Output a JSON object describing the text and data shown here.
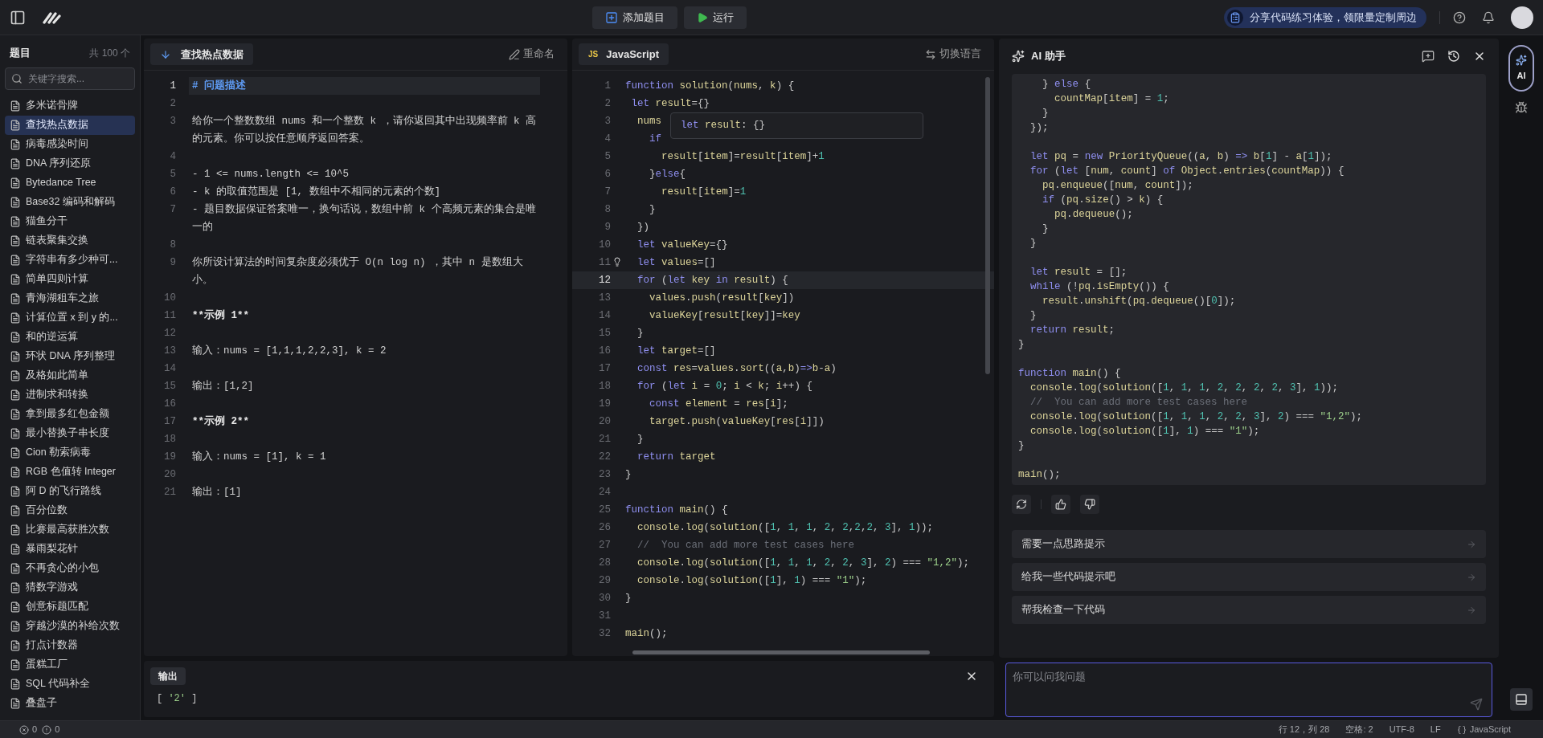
{
  "top_bar": {
    "buttons": [
      {
        "label": "添加题目",
        "kind": "add"
      },
      {
        "label": "运行",
        "kind": "run"
      }
    ],
    "promo": "分享代码练习体验，领限量定制周边"
  },
  "sidebar": {
    "title": "题目",
    "count": "共 100 个",
    "search": {
      "placeholder": "关键字搜索..."
    },
    "items": [
      {
        "label": "多米诺骨牌",
        "selected": false
      },
      {
        "label": "查找热点数据",
        "selected": true
      },
      {
        "label": "病毒感染时间",
        "selected": false
      },
      {
        "label": "DNA 序列还原",
        "selected": false
      },
      {
        "label": "Bytedance Tree",
        "selected": false
      },
      {
        "label": "Base32 编码和解码",
        "selected": false
      },
      {
        "label": "猫鱼分干",
        "selected": false
      },
      {
        "label": "链表聚集交换",
        "selected": false
      },
      {
        "label": "字符串有多少种可...",
        "selected": false
      },
      {
        "label": "简单四则计算",
        "selected": false
      },
      {
        "label": "青海湖租车之旅",
        "selected": false
      },
      {
        "label": "计算位置 x 到 y 的...",
        "selected": false
      },
      {
        "label": "和的逆运算",
        "selected": false
      },
      {
        "label": "环状 DNA 序列整理",
        "selected": false
      },
      {
        "label": "及格如此简单",
        "selected": false
      },
      {
        "label": "进制求和转换",
        "selected": false
      },
      {
        "label": "拿到最多红包金额",
        "selected": false
      },
      {
        "label": "最小替换子串长度",
        "selected": false
      },
      {
        "label": "Cion 勒索病毒",
        "selected": false
      },
      {
        "label": "RGB 色值转 Integer",
        "selected": false
      },
      {
        "label": "阿 D 的飞行路线",
        "selected": false
      },
      {
        "label": "百分位数",
        "selected": false
      },
      {
        "label": "比赛最高获胜次数",
        "selected": false
      },
      {
        "label": "暴雨梨花针",
        "selected": false
      },
      {
        "label": "不再贪心的小包",
        "selected": false
      },
      {
        "label": "猜数字游戏",
        "selected": false
      },
      {
        "label": "创意标题匹配",
        "selected": false
      },
      {
        "label": "穿越沙漠的补给次数",
        "selected": false
      },
      {
        "label": "打点计数器",
        "selected": false
      },
      {
        "label": "蛋糕工厂",
        "selected": false
      },
      {
        "label": "SQL 代码补全",
        "selected": false
      },
      {
        "label": "叠盘子",
        "selected": false
      }
    ]
  },
  "problem": {
    "tab": "查找热点数据",
    "rename": "重命名",
    "lines": [
      {
        "number": "1",
        "text": "# 问题描述",
        "kind": "heading",
        "current": true
      },
      {
        "number": "2",
        "current": false
      },
      {
        "number": "3",
        "text": "给你一个整数数组 nums 和一个整数 k ，请你返回其中出现频率前 k 高的元素。你可以按任意顺序返回答案。",
        "kind": "text",
        "current": false
      },
      {
        "number": "4",
        "current": false
      },
      {
        "number": "5",
        "text": "- 1 <= nums.length <= 10^5",
        "kind": "text",
        "current": false
      },
      {
        "number": "6",
        "text": "- k 的取值范围是 [1, 数组中不相同的元素的个数]",
        "kind": "text",
        "current": false
      },
      {
        "number": "7",
        "text": "- 题目数据保证答案唯一，换句话说，数组中前 k 个高频元素的集合是唯一的",
        "kind": "text",
        "current": false
      },
      {
        "number": "8",
        "current": false
      },
      {
        "number": "9",
        "text": "你所设计算法的时间复杂度必须优于 O(n log n) ，其中 n 是数组大小。",
        "kind": "text",
        "current": false
      },
      {
        "number": "10",
        "current": false
      },
      {
        "number": "11",
        "text": "**示例 1**",
        "kind": "strong",
        "current": false
      },
      {
        "number": "12",
        "current": false
      },
      {
        "number": "13",
        "text": "输入：nums = [1,1,1,2,2,3], k = 2",
        "kind": "text",
        "current": false
      },
      {
        "number": "14",
        "current": false
      },
      {
        "number": "15",
        "text": "输出：[1,2]",
        "kind": "text",
        "current": false
      },
      {
        "number": "16",
        "current": false
      },
      {
        "number": "17",
        "text": "**示例 2**",
        "kind": "strong",
        "current": false
      },
      {
        "number": "18",
        "current": false
      },
      {
        "number": "19",
        "text": "输入：nums = [1], k = 1",
        "kind": "text",
        "current": false
      },
      {
        "number": "20",
        "current": false
      },
      {
        "number": "21",
        "text": "输出：[1]",
        "kind": "text",
        "current": false
      }
    ]
  },
  "editor": {
    "badge": "JS",
    "language": "JavaScript",
    "switch": "切换语言",
    "tooltip": "let result: {}",
    "lines": [
      {
        "number": "1",
        "text": "function solution(nums, k) {",
        "current": false
      },
      {
        "number": "2",
        "text": " let result={}",
        "current": false
      },
      {
        "number": "3",
        "text": "  nums",
        "current": false
      },
      {
        "number": "4",
        "text": "    if",
        "current": false
      },
      {
        "number": "5",
        "text": "      result[item]=result[item]+1",
        "current": false
      },
      {
        "number": "6",
        "text": "    }else{",
        "current": false
      },
      {
        "number": "7",
        "text": "      result[item]=1",
        "current": false
      },
      {
        "number": "8",
        "text": "    }",
        "current": false
      },
      {
        "number": "9",
        "text": "  })",
        "current": false
      },
      {
        "number": "10",
        "text": "  let valueKey={}",
        "current": false
      },
      {
        "number": "11",
        "text": "  let values=[]",
        "current": false,
        "hint": true
      },
      {
        "number": "12",
        "text": "  for (let key in result) {",
        "current": true
      },
      {
        "number": "13",
        "text": "    values.push(result[key])",
        "current": false
      },
      {
        "number": "14",
        "text": "    valueKey[result[key]]=key",
        "current": false
      },
      {
        "number": "15",
        "text": "  }",
        "current": false
      },
      {
        "number": "16",
        "text": "  let target=[]",
        "current": false
      },
      {
        "number": "17",
        "text": "  const res=values.sort((a,b)=>b-a)",
        "current": false
      },
      {
        "number": "18",
        "text": "  for (let i = 0; i < k; i++) {",
        "current": false
      },
      {
        "number": "19",
        "text": "    const element = res[i];",
        "current": false
      },
      {
        "number": "20",
        "text": "    target.push(valueKey[res[i]])",
        "current": false
      },
      {
        "number": "21",
        "text": "  }",
        "current": false
      },
      {
        "number": "22",
        "text": "  return target",
        "current": false
      },
      {
        "number": "23",
        "text": "}",
        "current": false
      },
      {
        "number": "24",
        "current": false
      },
      {
        "number": "25",
        "text": "function main() {",
        "current": false
      },
      {
        "number": "26",
        "text": "  console.log(solution([1, 1, 1, 2, 2,2,2, 3], 1));",
        "current": false
      },
      {
        "number": "27",
        "text": "  //  You can add more test cases here",
        "current": false
      },
      {
        "number": "28",
        "text": "  console.log(solution([1, 1, 1, 2, 2, 3], 2) === \"1,2\");",
        "current": false
      },
      {
        "number": "29",
        "text": "  console.log(solution([1], 1) === \"1\");",
        "current": false
      },
      {
        "number": "30",
        "text": "}",
        "current": false
      },
      {
        "number": "31",
        "current": false
      },
      {
        "number": "32",
        "text": "main();",
        "current": false
      }
    ]
  },
  "output": {
    "tab": "输出",
    "text": "[ '2' ]"
  },
  "assistant": {
    "title": "AI 助手",
    "code": "    } else {\n      countMap[item] = 1;\n    }\n  });\n\n  let pq = new PriorityQueue((a, b) => b[1] - a[1]);\n  for (let [num, count] of Object.entries(countMap)) {\n    pq.enqueue([num, count]);\n    if (pq.size() > k) {\n      pq.dequeue();\n    }\n  }\n\n  let result = [];\n  while (!pq.isEmpty()) {\n    result.unshift(pq.dequeue()[0]);\n  }\n  return result;\n}\n\nfunction main() {\n  console.log(solution([1, 1, 1, 2, 2, 2, 2, 3], 1));\n  //  You can add more test cases here\n  console.log(solution([1, 1, 1, 2, 2, 3], 2) === \"1,2\");\n  console.log(solution([1], 1) === \"1\");\n}\n\nmain();",
    "suggestions": [
      "需要一点思路提示",
      "给我一些代码提示吧",
      "帮我检查一下代码"
    ],
    "input": {
      "placeholder": "你可以问我问题"
    }
  },
  "rail": {
    "ai_label": "AI"
  },
  "status_bar": {
    "errors": "0",
    "warnings": "0",
    "position": "行 12，列 28",
    "indent": "空格: 2",
    "encoding": "UTF-8",
    "eol": "LF",
    "language": "JavaScript"
  }
}
